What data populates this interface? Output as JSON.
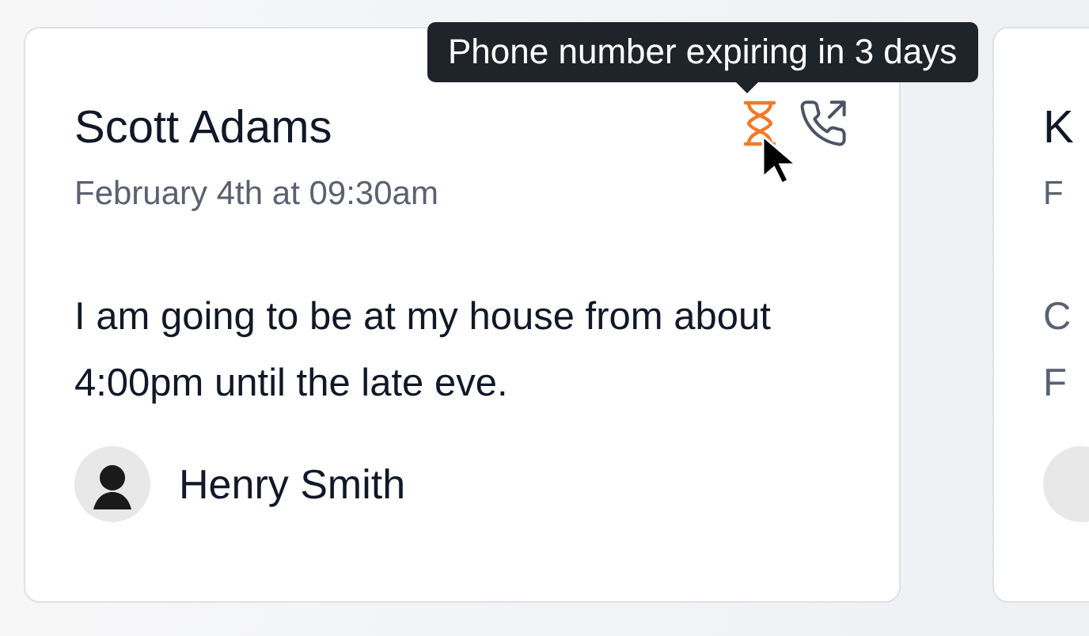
{
  "cards": [
    {
      "name": "Scott Adams",
      "date": "February 4th at 09:30am",
      "message": "I am going to be at my house from about 4:00pm until the late eve.",
      "author": "Henry Smith"
    },
    {
      "name": "K",
      "date": "F",
      "message_lines": [
        "C",
        "F"
      ]
    }
  ],
  "tooltip": {
    "text": "Phone number expiring in 3 days"
  }
}
